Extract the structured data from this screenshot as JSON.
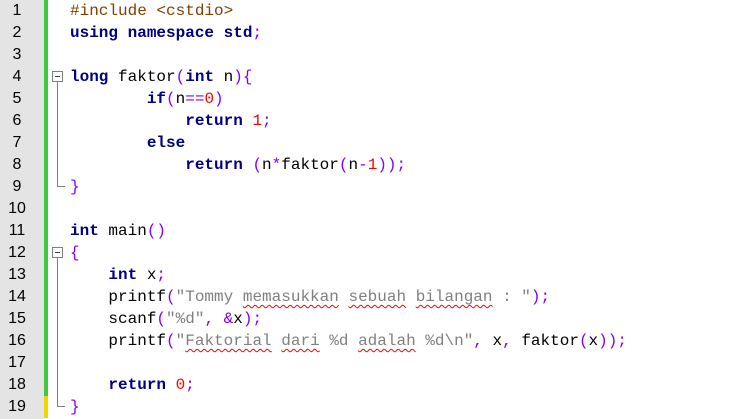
{
  "lines": [
    {
      "num": "1",
      "tokens": [
        {
          "t": "#include <cstdio>",
          "c": "pp"
        }
      ]
    },
    {
      "num": "2",
      "tokens": [
        {
          "t": "using namespace std",
          "c": "kw"
        },
        {
          "t": ";",
          "c": "op"
        }
      ]
    },
    {
      "num": "3",
      "tokens": []
    },
    {
      "num": "4",
      "tokens": [
        {
          "t": "long",
          "c": "kw"
        },
        {
          "t": " faktor",
          "c": ""
        },
        {
          "t": "(",
          "c": "op"
        },
        {
          "t": "int",
          "c": "kw"
        },
        {
          "t": " n",
          "c": ""
        },
        {
          "t": "){",
          "c": "op"
        }
      ]
    },
    {
      "num": "5",
      "tokens": [
        {
          "t": "        ",
          "c": ""
        },
        {
          "t": "if",
          "c": "kw"
        },
        {
          "t": "(",
          "c": "op"
        },
        {
          "t": "n",
          "c": ""
        },
        {
          "t": "==",
          "c": "op"
        },
        {
          "t": "0",
          "c": "num"
        },
        {
          "t": ")",
          "c": "op"
        }
      ]
    },
    {
      "num": "6",
      "tokens": [
        {
          "t": "            ",
          "c": ""
        },
        {
          "t": "return",
          "c": "kw"
        },
        {
          "t": " ",
          "c": ""
        },
        {
          "t": "1",
          "c": "num"
        },
        {
          "t": ";",
          "c": "op"
        }
      ]
    },
    {
      "num": "7",
      "tokens": [
        {
          "t": "        ",
          "c": ""
        },
        {
          "t": "else",
          "c": "kw"
        }
      ]
    },
    {
      "num": "8",
      "tokens": [
        {
          "t": "            ",
          "c": ""
        },
        {
          "t": "return",
          "c": "kw"
        },
        {
          "t": " ",
          "c": ""
        },
        {
          "t": "(",
          "c": "op"
        },
        {
          "t": "n",
          "c": ""
        },
        {
          "t": "*",
          "c": "op"
        },
        {
          "t": "faktor",
          "c": ""
        },
        {
          "t": "(",
          "c": "op"
        },
        {
          "t": "n",
          "c": ""
        },
        {
          "t": "-",
          "c": "op"
        },
        {
          "t": "1",
          "c": "num"
        },
        {
          "t": "));",
          "c": "op"
        }
      ]
    },
    {
      "num": "9",
      "tokens": [
        {
          "t": "}",
          "c": "op"
        }
      ]
    },
    {
      "num": "10",
      "tokens": []
    },
    {
      "num": "11",
      "tokens": [
        {
          "t": "int",
          "c": "kw"
        },
        {
          "t": " main",
          "c": ""
        },
        {
          "t": "()",
          "c": "op"
        }
      ]
    },
    {
      "num": "12",
      "tokens": [
        {
          "t": "{",
          "c": "op"
        }
      ]
    },
    {
      "num": "13",
      "tokens": [
        {
          "t": "    ",
          "c": ""
        },
        {
          "t": "int",
          "c": "kw"
        },
        {
          "t": " x",
          "c": ""
        },
        {
          "t": ";",
          "c": "op"
        }
      ]
    },
    {
      "num": "14",
      "tokens": [
        {
          "t": "    printf",
          "c": ""
        },
        {
          "t": "(",
          "c": "op"
        },
        {
          "t": "\"Tommy ",
          "c": "str"
        },
        {
          "t": "memasukkan",
          "c": "str sq"
        },
        {
          "t": " ",
          "c": "str"
        },
        {
          "t": "sebuah",
          "c": "str sq"
        },
        {
          "t": " ",
          "c": "str"
        },
        {
          "t": "bilangan",
          "c": "str sq"
        },
        {
          "t": " : \"",
          "c": "str"
        },
        {
          "t": ");",
          "c": "op"
        }
      ]
    },
    {
      "num": "15",
      "tokens": [
        {
          "t": "    scanf",
          "c": ""
        },
        {
          "t": "(",
          "c": "op"
        },
        {
          "t": "\"%d\"",
          "c": "str"
        },
        {
          "t": ", &",
          "c": "op"
        },
        {
          "t": "x",
          "c": ""
        },
        {
          "t": ");",
          "c": "op"
        }
      ]
    },
    {
      "num": "16",
      "tokens": [
        {
          "t": "    printf",
          "c": ""
        },
        {
          "t": "(",
          "c": "op"
        },
        {
          "t": "\"",
          "c": "str"
        },
        {
          "t": "Faktorial",
          "c": "str sq"
        },
        {
          "t": " ",
          "c": "str"
        },
        {
          "t": "dari",
          "c": "str sq"
        },
        {
          "t": " %d ",
          "c": "str"
        },
        {
          "t": "adalah",
          "c": "str sq"
        },
        {
          "t": " %d\\n\"",
          "c": "str"
        },
        {
          "t": ",",
          "c": "op"
        },
        {
          "t": " x",
          "c": ""
        },
        {
          "t": ",",
          "c": "op"
        },
        {
          "t": " faktor",
          "c": ""
        },
        {
          "t": "(",
          "c": "op"
        },
        {
          "t": "x",
          "c": ""
        },
        {
          "t": "));",
          "c": "op"
        }
      ]
    },
    {
      "num": "17",
      "tokens": []
    },
    {
      "num": "18",
      "tokens": [
        {
          "t": "    ",
          "c": ""
        },
        {
          "t": "return",
          "c": "kw"
        },
        {
          "t": " ",
          "c": ""
        },
        {
          "t": "0",
          "c": "num"
        },
        {
          "t": ";",
          "c": "op"
        }
      ]
    },
    {
      "num": "19",
      "tokens": [
        {
          "t": "}",
          "c": "op"
        }
      ]
    }
  ],
  "change_markers": {
    "green_lines": [
      "1",
      "2",
      "3",
      "4",
      "5",
      "6",
      "7",
      "8",
      "9",
      "10",
      "11",
      "12",
      "13",
      "14",
      "15",
      "16",
      "17",
      "18"
    ],
    "yellow_lines": [
      "19"
    ]
  },
  "colors": {
    "keyword": "#000080",
    "string": "#808080",
    "number": "#ff0000",
    "operator": "#8000ff",
    "preprocessor": "#804000",
    "change_saved": "#3ec93e",
    "change_unsaved": "#f2d400",
    "gutter": "#e4e4e4"
  },
  "icons": [
    "fold-minus-icon",
    "fold-end-icon"
  ]
}
